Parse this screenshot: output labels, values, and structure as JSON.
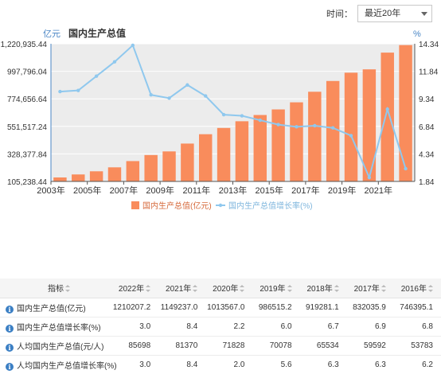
{
  "filter": {
    "label": "时间：",
    "value": "最近20年",
    "caret": "chevron-down-icon"
  },
  "colors": {
    "bar": "#f98c5c",
    "line": "#8fc8ee",
    "axis_left": "#4a86c5",
    "plot_bg": "#ececec"
  },
  "chart_data": {
    "type": "bar+line",
    "title": "国内生产总值",
    "left_unit": "亿元",
    "right_unit": "%",
    "x": [
      "2003年",
      "2004年",
      "2005年",
      "2006年",
      "2007年",
      "2008年",
      "2009年",
      "2010年",
      "2011年",
      "2012年",
      "2013年",
      "2014年",
      "2015年",
      "2016年",
      "2017年",
      "2018年",
      "2019年",
      "2020年",
      "2021年",
      "2022年"
    ],
    "x_tick_labels": [
      "2003年",
      "2005年",
      "2007年",
      "2009年",
      "2011年",
      "2013年",
      "2015年",
      "2017年",
      "2019年",
      "2021年"
    ],
    "y_left_ticks": [
      "1,220,935.44",
      "997,796.04",
      "774,656.64",
      "551,517.24",
      "328,377.84",
      "105,238.44"
    ],
    "y_left_range": [
      105238.44,
      1220935.44
    ],
    "y_right_ticks": [
      "14.34",
      "11.84",
      "9.34",
      "6.84",
      "4.34",
      "1.84"
    ],
    "y_right_range": [
      1.84,
      14.34
    ],
    "series": [
      {
        "name": "国内生产总值(亿元)",
        "type": "bar",
        "axis": "left",
        "values": [
          137422.0,
          161840.2,
          187318.9,
          219438.5,
          270092.3,
          319244.6,
          348517.7,
          412119.3,
          487940.2,
          538580.0,
          592963.2,
          643563.1,
          688858.2,
          746395.1,
          832035.9,
          919281.1,
          986515.2,
          1013567.0,
          1149237.0,
          1210207.2
        ]
      },
      {
        "name": "国内生产总值增长率(%)",
        "type": "line",
        "axis": "right",
        "values": [
          10.0,
          10.1,
          11.4,
          12.7,
          14.2,
          9.7,
          9.4,
          10.6,
          9.6,
          7.9,
          7.8,
          7.4,
          7.0,
          6.8,
          6.9,
          6.7,
          6.0,
          2.2,
          8.4,
          3.0
        ]
      }
    ]
  },
  "table": {
    "header": "指标",
    "years": [
      "2022年",
      "2021年",
      "2020年",
      "2019年",
      "2018年",
      "2017年",
      "2016年"
    ],
    "rows": [
      {
        "label": "国内生产总值(亿元)",
        "values": [
          "1210207.2",
          "1149237.0",
          "1013567.0",
          "986515.2",
          "919281.1",
          "832035.9",
          "746395.1"
        ]
      },
      {
        "label": "国内生产总值增长率(%)",
        "values": [
          "3.0",
          "8.4",
          "2.2",
          "6.0",
          "6.7",
          "6.9",
          "6.8"
        ]
      },
      {
        "label": "人均国内生产总值(元/人)",
        "values": [
          "85698",
          "81370",
          "71828",
          "70078",
          "65534",
          "59592",
          "53783"
        ]
      },
      {
        "label": "人均国内生产总值增长率(%)",
        "values": [
          "3.0",
          "8.4",
          "2.0",
          "5.6",
          "6.3",
          "6.3",
          "6.2"
        ]
      }
    ]
  }
}
